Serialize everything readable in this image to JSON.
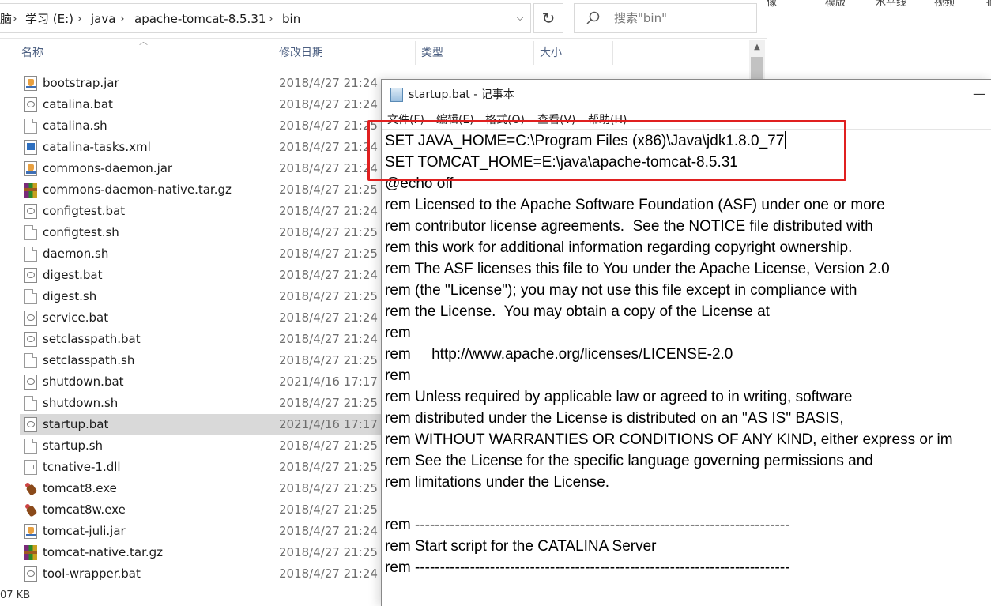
{
  "breadcrumb": {
    "cut_prefix": "脑",
    "items": [
      "学习 (E:)",
      "java",
      "apache-tomcat-8.5.31",
      "bin"
    ]
  },
  "search": {
    "placeholder": "搜索\"bin\""
  },
  "columns": {
    "name": "名称",
    "date": "修改日期",
    "type": "类型",
    "size": "大小"
  },
  "files": [
    {
      "name": "bootstrap.jar",
      "date": "2018/4/27 21:24",
      "icon": "jar-icon"
    },
    {
      "name": "catalina.bat",
      "date": "2018/4/27 21:24",
      "icon": "bat-icon"
    },
    {
      "name": "catalina.sh",
      "date": "2018/4/27 21:25",
      "icon": "doc-icon"
    },
    {
      "name": "catalina-tasks.xml",
      "date": "2018/4/27 21:24",
      "icon": "xml-icon"
    },
    {
      "name": "commons-daemon.jar",
      "date": "2018/4/27 21:24",
      "icon": "jar-icon"
    },
    {
      "name": "commons-daemon-native.tar.gz",
      "date": "2018/4/27 21:25",
      "icon": "archive-icon"
    },
    {
      "name": "configtest.bat",
      "date": "2018/4/27 21:24",
      "icon": "bat-icon"
    },
    {
      "name": "configtest.sh",
      "date": "2018/4/27 21:25",
      "icon": "doc-icon"
    },
    {
      "name": "daemon.sh",
      "date": "2018/4/27 21:25",
      "icon": "doc-icon"
    },
    {
      "name": "digest.bat",
      "date": "2018/4/27 21:24",
      "icon": "bat-icon"
    },
    {
      "name": "digest.sh",
      "date": "2018/4/27 21:25",
      "icon": "doc-icon"
    },
    {
      "name": "service.bat",
      "date": "2018/4/27 21:24",
      "icon": "bat-icon"
    },
    {
      "name": "setclasspath.bat",
      "date": "2018/4/27 21:24",
      "icon": "bat-icon"
    },
    {
      "name": "setclasspath.sh",
      "date": "2018/4/27 21:25",
      "icon": "doc-icon"
    },
    {
      "name": "shutdown.bat",
      "date": "2021/4/16 17:17",
      "icon": "bat-icon"
    },
    {
      "name": "shutdown.sh",
      "date": "2018/4/27 21:25",
      "icon": "doc-icon"
    },
    {
      "name": "startup.bat",
      "date": "2021/4/16 17:17",
      "icon": "bat-icon",
      "selected": true
    },
    {
      "name": "startup.sh",
      "date": "2018/4/27 21:25",
      "icon": "doc-icon"
    },
    {
      "name": "tcnative-1.dll",
      "date": "2018/4/27 21:25",
      "icon": "dll-icon"
    },
    {
      "name": "tomcat8.exe",
      "date": "2018/4/27 21:25",
      "icon": "exe-icon"
    },
    {
      "name": "tomcat8w.exe",
      "date": "2018/4/27 21:25",
      "icon": "exe-icon"
    },
    {
      "name": "tomcat-juli.jar",
      "date": "2018/4/27 21:24",
      "icon": "jar-icon"
    },
    {
      "name": "tomcat-native.tar.gz",
      "date": "2018/4/27 21:25",
      "icon": "archive-icon"
    },
    {
      "name": "tool-wrapper.bat",
      "date": "2018/4/27 21:24",
      "icon": "bat-icon"
    }
  ],
  "status_bar": {
    "text": "07 KB"
  },
  "background_window": {
    "items": [
      "像",
      "模版",
      "水平线",
      "视频",
      "摘要"
    ]
  },
  "notepad": {
    "title": "startup.bat - 记事本",
    "minimize": "—",
    "menu": [
      "文件(F)",
      "编辑(E)",
      "格式(O)",
      "查看(V)",
      "帮助(H)"
    ],
    "lines": [
      "SET JAVA_HOME=C:\\Program Files (x86)\\Java\\jdk1.8.0_77",
      "SET TOMCAT_HOME=E:\\java\\apache-tomcat-8.5.31",
      "@echo off",
      "rem Licensed to the Apache Software Foundation (ASF) under one or more",
      "rem contributor license agreements.  See the NOTICE file distributed with",
      "rem this work for additional information regarding copyright ownership.",
      "rem The ASF licenses this file to You under the Apache License, Version 2.0",
      "rem (the \"License\"); you may not use this file except in compliance with",
      "rem the License.  You may obtain a copy of the License at",
      "rem",
      "rem     http://www.apache.org/licenses/LICENSE-2.0",
      "rem",
      "rem Unless required by applicable law or agreed to in writing, software",
      "rem distributed under the License is distributed on an \"AS IS\" BASIS,",
      "rem WITHOUT WARRANTIES OR CONDITIONS OF ANY KIND, either express or im",
      "rem See the License for the specific language governing permissions and",
      "rem limitations under the License.",
      "",
      "rem ---------------------------------------------------------------------------",
      "rem Start script for the CATALINA Server",
      "rem ---------------------------------------------------------------------------"
    ]
  },
  "annotation": {
    "color": "#e02020"
  }
}
